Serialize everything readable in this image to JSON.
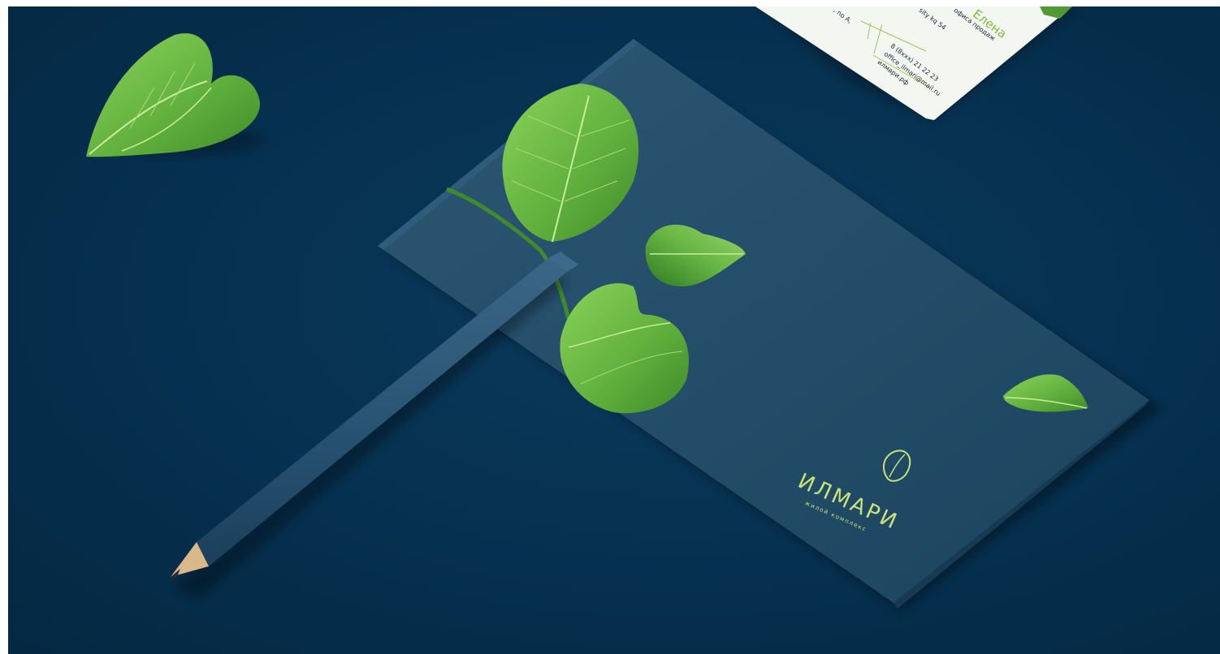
{
  "scene": {
    "background_color": "#06304f",
    "leaf_color": "#5fae3c",
    "leaf_highlight": "#8bd35a",
    "accent_color": "#c8e27a"
  },
  "envelope": {
    "brand_name": "ИЛМАРИ",
    "brand_tagline": "жилой комплекс",
    "logo_icon": "leaf-logo-icon"
  },
  "business_card": {
    "name": "Елена",
    "title": "офиса продаж",
    "line_1": "sity kq 54",
    "line_2": ", no A,",
    "phone": "8 (8xxx) 21 22 23",
    "email": "office_ilmari@mail.ru",
    "website": "илмари.рф"
  }
}
